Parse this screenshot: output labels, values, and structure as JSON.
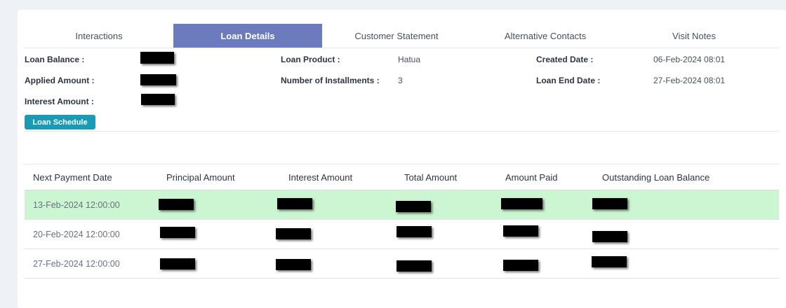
{
  "tabs": [
    {
      "label": "Interactions"
    },
    {
      "label": "Loan Details"
    },
    {
      "label": "Customer Statement"
    },
    {
      "label": "Alternative Contacts"
    },
    {
      "label": "Visit Notes"
    }
  ],
  "active_tab": "Loan Details",
  "details": {
    "loan_balance_label": "Loan Balance :",
    "applied_amount_label": "Applied Amount :",
    "interest_amount_label": "Interest Amount :",
    "loan_product_label": "Loan Product :",
    "loan_product_value": "Hatua",
    "installments_label": "Number of Installments :",
    "installments_value": "3",
    "created_date_label": "Created Date :",
    "created_date_value": "06-Feb-2024 08:01",
    "loan_end_date_label": "Loan End Date :",
    "loan_end_date_value": "27-Feb-2024 08:01"
  },
  "schedule_button_label": "Loan Schedule",
  "table": {
    "headers": [
      "Next Payment Date",
      "Principal Amount",
      "Interest Amount",
      "Total Amount",
      "Amount Paid",
      "Outstanding Loan Balance"
    ],
    "rows": [
      {
        "date": "13-Feb-2024 12:00:00",
        "highlighted": true
      },
      {
        "date": "20-Feb-2024 12:00:00",
        "highlighted": false
      },
      {
        "date": "27-Feb-2024 12:00:00",
        "highlighted": false
      }
    ]
  },
  "colors": {
    "active_tab": "#6c7bbd",
    "button": "#1a9bb5",
    "highlight_row": "#ccf5d1",
    "redaction": "#000000"
  }
}
